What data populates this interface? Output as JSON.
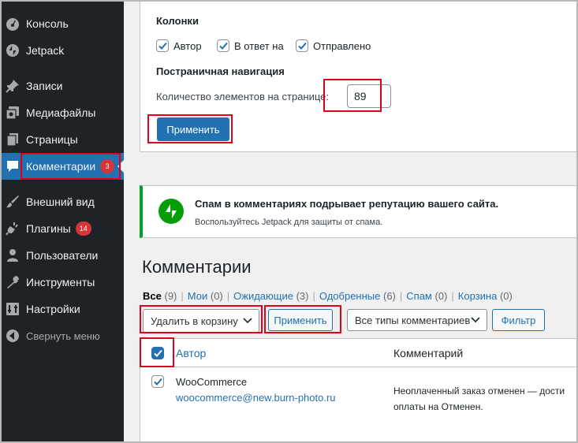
{
  "sidebar": {
    "items": [
      {
        "label": "Консоль",
        "icon": "dashboard-icon"
      },
      {
        "label": "Jetpack",
        "icon": "jetpack-icon"
      },
      {
        "label": "Записи",
        "icon": "pin-icon"
      },
      {
        "label": "Медиафайлы",
        "icon": "media-icon"
      },
      {
        "label": "Страницы",
        "icon": "pages-icon"
      },
      {
        "label": "Комментарии",
        "icon": "comment-icon",
        "badge": "3",
        "active": true
      },
      {
        "label": "Внешний вид",
        "icon": "brush-icon"
      },
      {
        "label": "Плагины",
        "icon": "plugin-icon",
        "badge": "14"
      },
      {
        "label": "Пользователи",
        "icon": "user-icon"
      },
      {
        "label": "Инструменты",
        "icon": "wrench-icon"
      },
      {
        "label": "Настройки",
        "icon": "settings-icon"
      },
      {
        "label": "Свернуть меню",
        "icon": "collapse-icon"
      }
    ]
  },
  "screen_options": {
    "columns_label": "Колонки",
    "columns": [
      {
        "label": "Автор",
        "checked": true
      },
      {
        "label": "В ответ на",
        "checked": true
      },
      {
        "label": "Отправлено",
        "checked": true
      }
    ],
    "pagination_label": "Постраничная навигация",
    "per_page_label": "Количество элементов на странице:",
    "per_page_value": "89",
    "apply_label": "Применить"
  },
  "notice": {
    "title": "Спам в комментариях подрывает репутацию вашего сайта.",
    "text": "Воспользуйтесь Jetpack для защиты от спама."
  },
  "page_title": "Комментарии",
  "filters": [
    {
      "label": "Все",
      "count": "(9)",
      "current": true
    },
    {
      "label": "Мои",
      "count": "(0)"
    },
    {
      "label": "Ожидающие",
      "count": "(3)"
    },
    {
      "label": "Одобренные",
      "count": "(6)"
    },
    {
      "label": "Спам",
      "count": "(0)"
    },
    {
      "label": "Корзина",
      "count": "(0)"
    }
  ],
  "bulk": {
    "action_value": "Удалить в корзину",
    "apply_label": "Применить",
    "type_value": "Все типы комментариев",
    "filter_label": "Фильтр"
  },
  "table": {
    "col_author": "Автор",
    "col_comment": "Комментарий",
    "rows": [
      {
        "author": "WooCommerce",
        "email": "woocommerce@new.burn-photo.ru",
        "comment_line1": "Неоплаченный заказ отменен — дости",
        "comment_line2": "оплаты на Отменен.",
        "checked": true
      }
    ]
  },
  "colors": {
    "sidebar_bg": "#1d2327",
    "accent": "#2271b1",
    "badge": "#d63638",
    "highlight": "#e0001b",
    "notice_border": "#00a32a"
  }
}
